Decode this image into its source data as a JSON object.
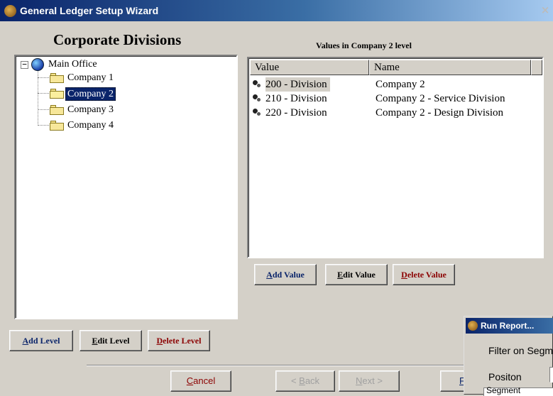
{
  "window": {
    "title": "General Ledger Setup Wizard",
    "close_glyph": "×"
  },
  "page": {
    "heading": "Corporate Divisions"
  },
  "tree": {
    "root": {
      "label": "Main Office",
      "expander": "−"
    },
    "children": [
      {
        "label": "Company 1",
        "selected": false
      },
      {
        "label": "Company 2",
        "selected": true
      },
      {
        "label": "Company 3",
        "selected": false
      },
      {
        "label": "Company 4",
        "selected": false
      }
    ]
  },
  "values_panel": {
    "caption": "Values in Company 2 level",
    "columns": [
      "Value",
      "Name"
    ],
    "rows": [
      {
        "value": "200 - Division",
        "name": "Company 2",
        "selected": true
      },
      {
        "value": "210 - Division",
        "name": "Company 2 - Service Division",
        "selected": false
      },
      {
        "value": "220 - Division",
        "name": "Company 2 - Design Division",
        "selected": false
      }
    ]
  },
  "value_buttons": {
    "add": {
      "first": "A",
      "rest": "dd Value"
    },
    "edit": {
      "first": "E",
      "rest": "dit Value"
    },
    "delete": {
      "first": "D",
      "rest": "elete Value"
    }
  },
  "level_buttons": {
    "add": {
      "first": "A",
      "rest": "dd Level"
    },
    "edit": {
      "first": "E",
      "rest": "dit Level"
    },
    "delete": {
      "first": "D",
      "rest": "elete Level"
    }
  },
  "nav_buttons": {
    "cancel": {
      "first": "C",
      "rest": "ancel"
    },
    "back": {
      "first": "< ",
      "ul": "B",
      "rest": "ack"
    },
    "next": {
      "first": "N",
      "rest": "ext >"
    },
    "finish_partial": "F"
  },
  "popup": {
    "title": "Run Report...",
    "filter_label": "Filter on Segm",
    "position_label": "Positon",
    "field_text": "Segment"
  },
  "colors": {
    "titlebar_start": "#0a246a",
    "titlebar_end": "#a6caf0",
    "selection": "#0a246a",
    "dialog_bg": "#d4d0c8"
  }
}
